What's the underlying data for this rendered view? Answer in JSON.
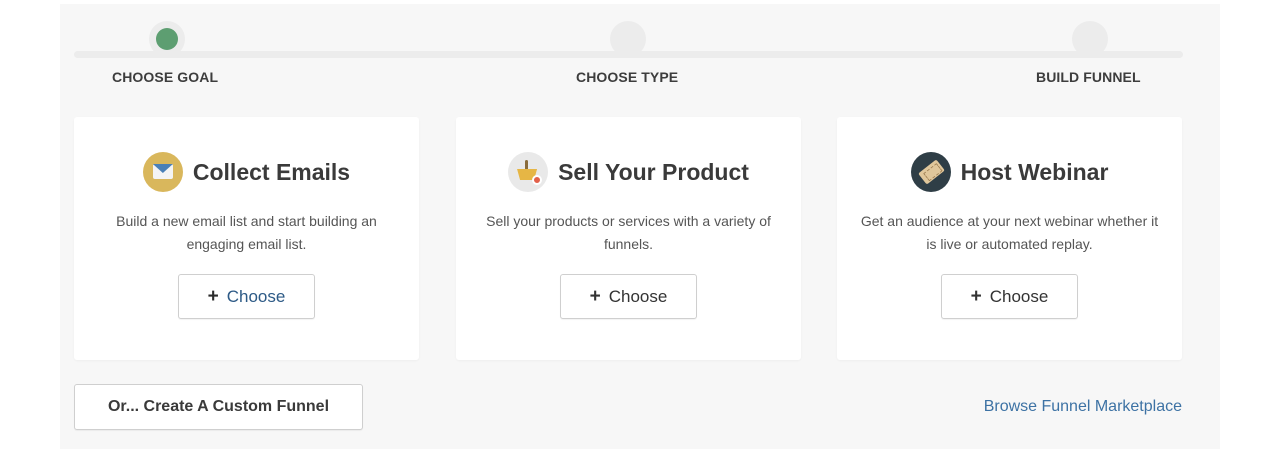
{
  "steps": [
    {
      "label": "CHOOSE GOAL",
      "active": true
    },
    {
      "label": "CHOOSE TYPE",
      "active": false
    },
    {
      "label": "BUILD FUNNEL",
      "active": false
    }
  ],
  "cards": [
    {
      "title": "Collect Emails",
      "icon": "envelope-icon",
      "description": "Build a new email list and start building an engaging email list.",
      "button_label": "Choose"
    },
    {
      "title": "Sell Your Product",
      "icon": "basket-icon",
      "description": "Sell your products or services with a variety of funnels.",
      "button_label": "Choose"
    },
    {
      "title": "Host Webinar",
      "icon": "ticket-icon",
      "description": "Get an audience at your next webinar whether it is live or automated replay.",
      "button_label": "Choose"
    }
  ],
  "custom_funnel_label": "Or... Create A Custom Funnel",
  "browse_marketplace_label": "Browse Funnel Marketplace",
  "colors": {
    "active_step": "#5d9e71",
    "link": "#3d72a4",
    "panel_bg": "#f7f7f7"
  }
}
